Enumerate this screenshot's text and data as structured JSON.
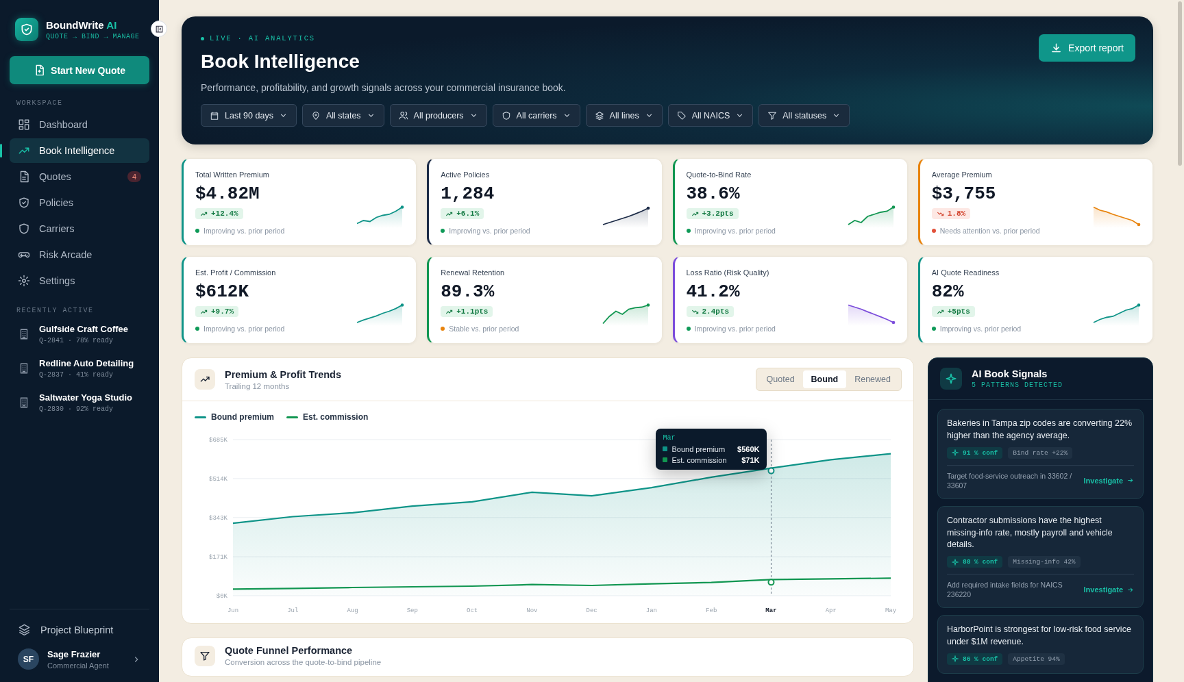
{
  "sidebar": {
    "brand": {
      "name": "BoundWrite",
      "accent": "AI",
      "tagline": "QUOTE → BIND → MANAGE"
    },
    "new_quote_button": "Start New Quote",
    "workspace_label": "WORKSPACE",
    "items": [
      {
        "label": "Dashboard",
        "selected": false
      },
      {
        "label": "Book Intelligence",
        "selected": true
      },
      {
        "label": "Quotes",
        "selected": false,
        "badge": "4"
      },
      {
        "label": "Policies",
        "selected": false
      },
      {
        "label": "Carriers",
        "selected": false
      },
      {
        "label": "Risk Arcade",
        "selected": false
      },
      {
        "label": "Settings",
        "selected": false
      }
    ],
    "recent_label": "RECENTLY ACTIVE",
    "recent": [
      {
        "name": "Gulfside Craft Coffee",
        "meta": "Q-2841 · 78% ready"
      },
      {
        "name": "Redline Auto Detailing",
        "meta": "Q-2837 · 41% ready"
      },
      {
        "name": "Saltwater Yoga Studio",
        "meta": "Q-2830 · 92% ready"
      }
    ],
    "footer_link": "Project Blueprint",
    "user": {
      "initials": "SF",
      "name": "Sage Frazier",
      "role": "Commercial Agent"
    }
  },
  "header": {
    "eyebrow": "LIVE · AI ANALYTICS",
    "title": "Book Intelligence",
    "subtitle": "Performance, profitability, and growth signals across your commercial insurance book.",
    "export_button": "Export report",
    "filters": [
      "Last 90 days",
      "All states",
      "All producers",
      "All carriers",
      "All lines",
      "All NAICS",
      "All statuses"
    ]
  },
  "kpis": [
    {
      "label": "Total Written Premium",
      "value": "$4.82M",
      "delta": {
        "text": "+12.4%",
        "falling": false,
        "positive": true
      },
      "note": {
        "text": "Improving vs. prior period",
        "color": "#0f9a58"
      },
      "color": "#0f9488"
    },
    {
      "label": "Active Policies",
      "value": "1,284",
      "delta": {
        "text": "+6.1%",
        "falling": false,
        "positive": true
      },
      "note": {
        "text": "Improving vs. prior period",
        "color": "#0f9a58"
      },
      "color": "#1c2b47"
    },
    {
      "label": "Quote-to-Bind Rate",
      "value": "38.6%",
      "delta": {
        "text": "+3.2pts",
        "falling": false,
        "positive": true
      },
      "note": {
        "text": "Improving vs. prior period",
        "color": "#0f9a58"
      },
      "color": "#119651"
    },
    {
      "label": "Average Premium",
      "value": "$3,755",
      "delta": {
        "text": "1.8%",
        "falling": true,
        "positive": false
      },
      "note": {
        "text": "Needs attention vs. prior period",
        "color": "#e2513a"
      },
      "color": "#e8830c"
    },
    {
      "label": "Est. Profit / Commission",
      "value": "$612K",
      "delta": {
        "text": "+9.7%",
        "falling": false,
        "positive": true
      },
      "note": {
        "text": "Improving vs. prior period",
        "color": "#0f9a58"
      },
      "color": "#0f9488"
    },
    {
      "label": "Renewal Retention",
      "value": "89.3%",
      "delta": {
        "text": "+1.1pts",
        "falling": false,
        "positive": true
      },
      "note": {
        "text": "Stable vs. prior period",
        "color": "#e8830c"
      },
      "color": "#119651"
    },
    {
      "label": "Loss Ratio (Risk Quality)",
      "value": "41.2%",
      "delta": {
        "text": "2.4pts",
        "falling": true,
        "positive": true
      },
      "note": {
        "text": "Improving vs. prior period",
        "color": "#0f9a58"
      },
      "color": "#7c4ddb"
    },
    {
      "label": "AI Quote Readiness",
      "value": "82%",
      "delta": {
        "text": "+5pts",
        "falling": false,
        "positive": true
      },
      "note": {
        "text": "Improving vs. prior period",
        "color": "#0f9a58"
      },
      "color": "#0f9488"
    }
  ],
  "trends": {
    "title": "Premium & Profit Trends",
    "subtitle": "Trailing 12 months",
    "segments": [
      {
        "label": "Quoted",
        "selected": false
      },
      {
        "label": "Bound",
        "selected": true
      },
      {
        "label": "Renewed",
        "selected": false
      }
    ],
    "tooltip": {
      "title": "Mar",
      "rows": [
        {
          "name": "Bound premium",
          "value": "$560K"
        },
        {
          "name": "Est. commission",
          "value": "$71K"
        }
      ]
    },
    "chart_data": {
      "type": "line",
      "categories": [
        "Jun",
        "Jul",
        "Aug",
        "Sep",
        "Oct",
        "Nov",
        "Dec",
        "Jan",
        "Feb",
        "Mar",
        "Apr",
        "May"
      ],
      "series": [
        {
          "name": "Bound premium",
          "type": "area",
          "color": "#0f9488",
          "values": [
            318,
            347,
            364,
            393,
            412,
            454,
            438,
            474,
            520,
            560,
            597,
            623
          ]
        },
        {
          "name": "Est. commission",
          "type": "line",
          "color": "#119651",
          "values": [
            29,
            32,
            36,
            39,
            42,
            49,
            45,
            52,
            58,
            71,
            74,
            77
          ]
        }
      ],
      "ylim": [
        0,
        685
      ],
      "yticks": [
        {
          "value": 0,
          "label": "$0K"
        },
        {
          "value": 171,
          "label": "$171K"
        },
        {
          "value": 343,
          "label": "$343K"
        },
        {
          "value": 514,
          "label": "$514K"
        },
        {
          "value": 685,
          "label": "$685K"
        }
      ],
      "grid": true,
      "legend": "top",
      "ref_lines": [
        {
          "axis": "x",
          "value": "Mar"
        }
      ]
    }
  },
  "funnel": {
    "title": "Quote Funnel Performance",
    "subtitle": "Conversion across the quote-to-bind pipeline"
  },
  "signals": {
    "title": "AI Book Signals",
    "subtitle": "5 PATTERNS DETECTED",
    "items": [
      {
        "text": "Bakeries in Tampa zip codes are converting 22% higher than the agency average.",
        "confidence": "91 % conf",
        "tag": "Bind rate +22%",
        "action": "Target food-service outreach in 33602 / 33607",
        "link": "Investigate"
      },
      {
        "text": "Contractor submissions have the highest missing-info rate, mostly payroll and vehicle details.",
        "confidence": "88 % conf",
        "tag": "Missing-info 42%",
        "action": "Add required intake fields for NAICS 236220",
        "link": "Investigate"
      },
      {
        "text": "HarborPoint is strongest for low-risk food service under $1M revenue.",
        "confidence": "86 % conf",
        "tag": "Appetite 94%"
      }
    ]
  }
}
